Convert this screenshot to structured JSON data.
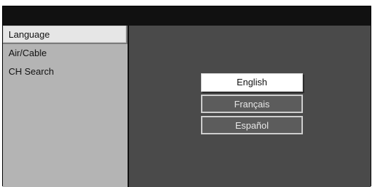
{
  "sidebar": {
    "items": [
      {
        "label": "Language",
        "selected": true
      },
      {
        "label": "Air/Cable",
        "selected": false
      },
      {
        "label": "CH Search",
        "selected": false
      }
    ]
  },
  "language_menu": {
    "options": [
      {
        "label": "English",
        "selected": true
      },
      {
        "label": "Français",
        "selected": false
      },
      {
        "label": "Español",
        "selected": false
      }
    ]
  },
  "colors": {
    "sidebar_bg": "#b4b4b4",
    "content_bg": "#4a4a4a",
    "header_bg": "#111111",
    "selected_option_bg": "#ffffff",
    "option_bg": "#5c5c5c",
    "option_border": "#cfcfcf"
  }
}
